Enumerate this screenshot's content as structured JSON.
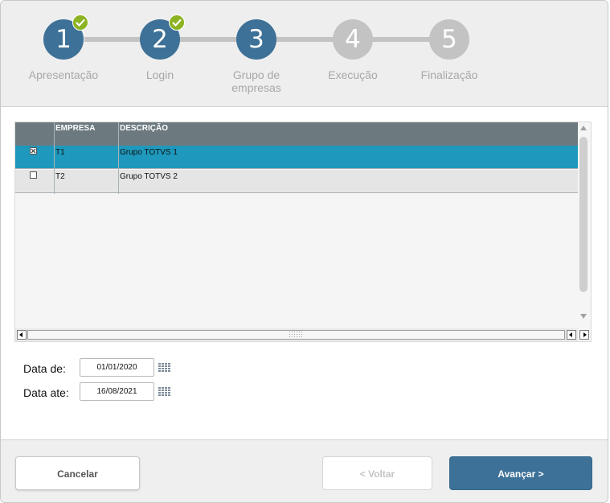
{
  "steps": [
    {
      "number": "1",
      "label": "Apresentação",
      "status": "done"
    },
    {
      "number": "2",
      "label": "Login",
      "status": "done"
    },
    {
      "number": "3",
      "label": "Grupo de empresas",
      "status": "current"
    },
    {
      "number": "4",
      "label": "Execução",
      "status": "pending"
    },
    {
      "number": "5",
      "label": "Finalização",
      "status": "pending"
    }
  ],
  "grid": {
    "columns": [
      "EMPRESA",
      "DESCRIÇÃO"
    ],
    "rows": [
      {
        "checked": true,
        "empresa": "T1",
        "descricao": "Grupo TOTVS 1",
        "selected": true
      },
      {
        "checked": false,
        "empresa": "T2",
        "descricao": "Grupo TOTVS 2",
        "selected": false
      }
    ]
  },
  "dates": {
    "from_label": "Data de:",
    "from_value": "01/01/2020",
    "to_label": "Data ate:",
    "to_value": "16/08/2021"
  },
  "buttons": {
    "cancel": "Cancelar",
    "back": "< Voltar",
    "next": "Avançar >"
  },
  "colors": {
    "step_active": "#3d7197",
    "step_pending": "#c3c3c3",
    "check_badge": "#8cb321",
    "row_selected": "#1e99bd",
    "grid_header": "#6c7a80",
    "primary_button": "#3d7197"
  },
  "icons": {
    "step_done": "checkmark-icon",
    "date_picker": "calendar-grid-icon"
  }
}
